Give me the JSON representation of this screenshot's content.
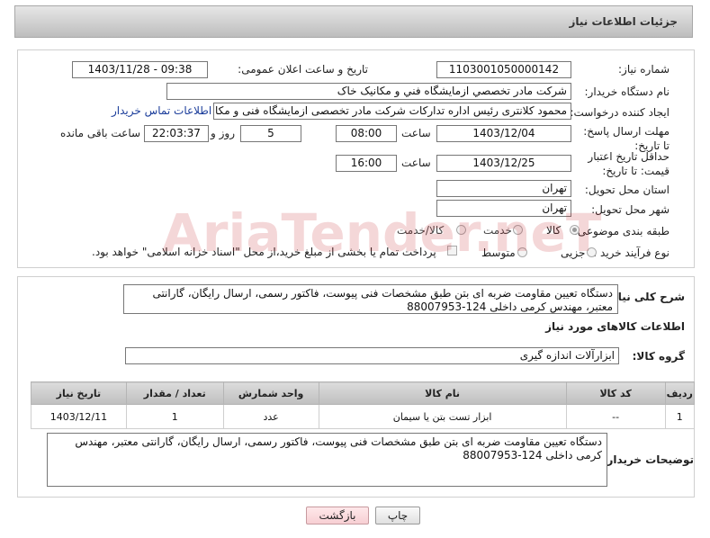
{
  "header": {
    "title": "جزئیات اطلاعات نیاز"
  },
  "form": {
    "need_number_label": "شماره نیاز:",
    "need_number": "1103001050000142",
    "announce_label": "تاریخ و ساعت اعلان عمومی:",
    "announce_value": "1403/11/28 - 09:38",
    "buyer_org_label": "نام دستگاه خریدار:",
    "buyer_org": "شرکت مادر تخصصي ازمايشگاه فني و مکانيک خاک",
    "creator_label": "ایجاد کننده درخواست:",
    "creator": "محمود کلانتری رئیس اداره تدارکات شرکت مادر تخصصی ازمایشگاه فنی و مکانیک",
    "contact_link": "اطلاعات تماس خریدار",
    "deadline_label": "مهلت ارسال پاسخ: تا تاریخ:",
    "deadline_date": "1403/12/04",
    "time_label": "ساعت",
    "deadline_time": "08:00",
    "days_value": "5",
    "days_label": "روز و",
    "remaining_time": "22:03:37",
    "remaining_label": "ساعت باقی مانده",
    "validity_label": "حداقل تاریخ اعتبار قیمت: تا تاریخ:",
    "validity_date": "1403/12/25",
    "validity_time": "16:00",
    "province_label": "استان محل تحویل:",
    "province": "تهران",
    "city_label": "شهر محل تحویل:",
    "city": "تهران",
    "category_label": "طبقه بندی موضوعی:",
    "category_options": [
      "کالا",
      "خدمت",
      "کالا/خدمت"
    ],
    "process_label": "نوع فرآیند خرید :",
    "process_options": [
      "جزیی",
      "متوسط"
    ],
    "payment_note": "پرداخت تمام یا بخشی از مبلغ خرید،از محل \"اسناد خزانه اسلامی\" خواهد بود."
  },
  "details": {
    "description_label": "شرح کلی نیاز:",
    "description": "دستگاه تعیین مقاومت ضربه ای بتن طبق مشخصات فنی پیوست، فاکتور رسمی، ارسال رایگان، گارانتی معتبر، مهندس کرمی داخلی 124-88007953",
    "goods_info_label": "اطلاعات کالاهای مورد نیاز",
    "goods_group_label": "گروه کالا:",
    "goods_group": "ابزارآلات اندازه گیری",
    "table": {
      "headers": [
        "ردیف",
        "کد کالا",
        "نام کالا",
        "واحد شمارش",
        "تعداد / مقدار",
        "تاریخ نیاز"
      ],
      "rows": [
        [
          "1",
          "--",
          "ابزار تست بتن یا سیمان",
          "عدد",
          "1",
          "1403/12/11"
        ]
      ]
    },
    "buyer_notes_label": "توضیحات خریدار:",
    "buyer_notes": "دستگاه تعیین مقاومت ضربه ای بتن طبق مشخصات فنی پیوست، فاکتور رسمی، ارسال رایگان، گارانتی معتبر، مهندس کرمی داخلی 124-88007953"
  },
  "buttons": {
    "print": "چاپ",
    "back": "بازگشت"
  },
  "watermark": {
    "text": "AriaTender.neT"
  }
}
